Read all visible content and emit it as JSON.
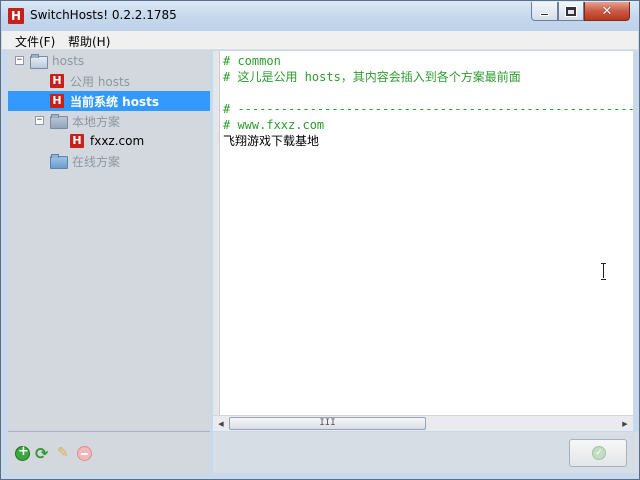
{
  "window": {
    "title": "SwitchHosts! 0.2.2.1785",
    "app_icon_letter": "H",
    "close_glyph": "✕"
  },
  "menubar": {
    "items": [
      {
        "label": "文件(F)"
      },
      {
        "label": "帮助(H)"
      }
    ]
  },
  "tree": {
    "root": {
      "label": "hosts",
      "expander": "−"
    },
    "common": {
      "label": "公用 hosts",
      "icon_letter": "H"
    },
    "current": {
      "label": "当前系统 hosts",
      "icon_letter": "H"
    },
    "local_group": {
      "label": "本地方案",
      "expander": "−"
    },
    "local_items": [
      {
        "label": "fxxz.com",
        "icon_letter": "H"
      }
    ],
    "online_group": {
      "label": "在线方案"
    }
  },
  "toolbar": {
    "refresh_glyph": "⟳",
    "edit_glyph": "✎"
  },
  "editor": {
    "lines": [
      "# common",
      "# 这儿是公用 hosts，其内容会插入到各个方案最前面",
      "",
      "# -------------------------------------------------------------",
      "# www.fxxz.com",
      "飞翔游戏下载基地"
    ],
    "line_types": [
      "comment",
      "comment",
      "blank",
      "comment",
      "comment",
      "text"
    ]
  },
  "scrollbar": {
    "left_arrow": "◀",
    "right_arrow": "▶",
    "thumb_grip": "III"
  },
  "save_button": {
    "glyph": "✓"
  },
  "colors": {
    "comment": "#2e9c2e",
    "selection": "#3399ff",
    "brand_red": "#c8201a"
  }
}
